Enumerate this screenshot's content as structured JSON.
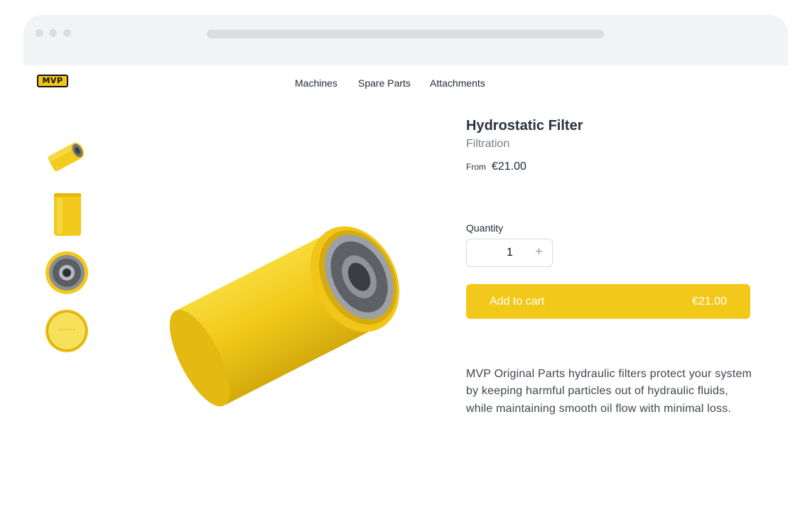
{
  "browser": {
    "url": ""
  },
  "brand": {
    "logo_text": "MVP",
    "logo_color": "#f5c518"
  },
  "nav": {
    "items": [
      {
        "label": "Machines"
      },
      {
        "label": "Spare Parts"
      },
      {
        "label": "Attachments"
      }
    ]
  },
  "gallery": {
    "thumbnails": [
      {
        "view": "angled"
      },
      {
        "view": "side"
      },
      {
        "view": "top"
      },
      {
        "view": "bottom"
      }
    ],
    "main_image": "hydraulic-filter-angled"
  },
  "product": {
    "title": "Hydrostatic Filter",
    "category": "Filtration",
    "from_label": "From",
    "price": "€21.00",
    "quantity_label": "Quantity",
    "quantity": "1",
    "plus_symbol": "+",
    "add_to_cart_label": "Add to cart",
    "add_to_cart_price": "€21.00",
    "description": "MVP Original Parts hydraulic filters protect your system by keeping harmful particles out of hydraulic fluids, while maintaining smooth oil flow with minimal loss."
  },
  "colors": {
    "accent": "#f2c91a",
    "text_dark": "#2b3240",
    "text_muted": "#7a7f87"
  }
}
